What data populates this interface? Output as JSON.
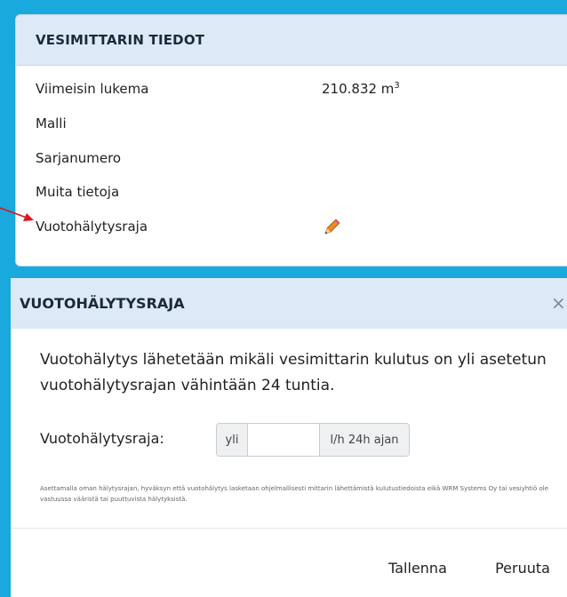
{
  "meter_info": {
    "title": "VESIMITTARIN TIEDOT",
    "rows": [
      {
        "label": "Viimeisin lukema",
        "value": "210.832 m",
        "unit_sup": "3"
      },
      {
        "label": "Malli",
        "value": ""
      },
      {
        "label": "Sarjanumero",
        "value": ""
      },
      {
        "label": "Muita tietoja",
        "value": ""
      },
      {
        "label": "Vuotohälytysraja",
        "icon": "pencil-icon"
      }
    ]
  },
  "modal": {
    "title": "VUOTOHÄLYTYSRAJA",
    "close_label": "×",
    "description": "Vuotohälytys lähetetään mikäli vesimittarin kulutus on yli asetetun vuotohälytysrajan vähintään 24 tuntia.",
    "limit_label": "Vuotohälytysraja:",
    "prefix": "yli",
    "suffix": "l/h 24h ajan",
    "input_value": "",
    "fineprint": "Asettamalla oman hälytysrajan, hyväksyn että vuotohälytys lasketaan ohjelmallisesti mittarin lähettämistä kulutustiedoista eikä WRM Systems Oy tai vesiyhtiö ole vastuussa vääristä tai puuttuvista hälytyksistä.",
    "save_label": "Tallenna",
    "cancel_label": "Peruuta"
  },
  "colors": {
    "background": "#19a9dc",
    "header_bg": "#dde9f7",
    "arrow": "#e0141e",
    "pencil": "#f08a1c"
  }
}
